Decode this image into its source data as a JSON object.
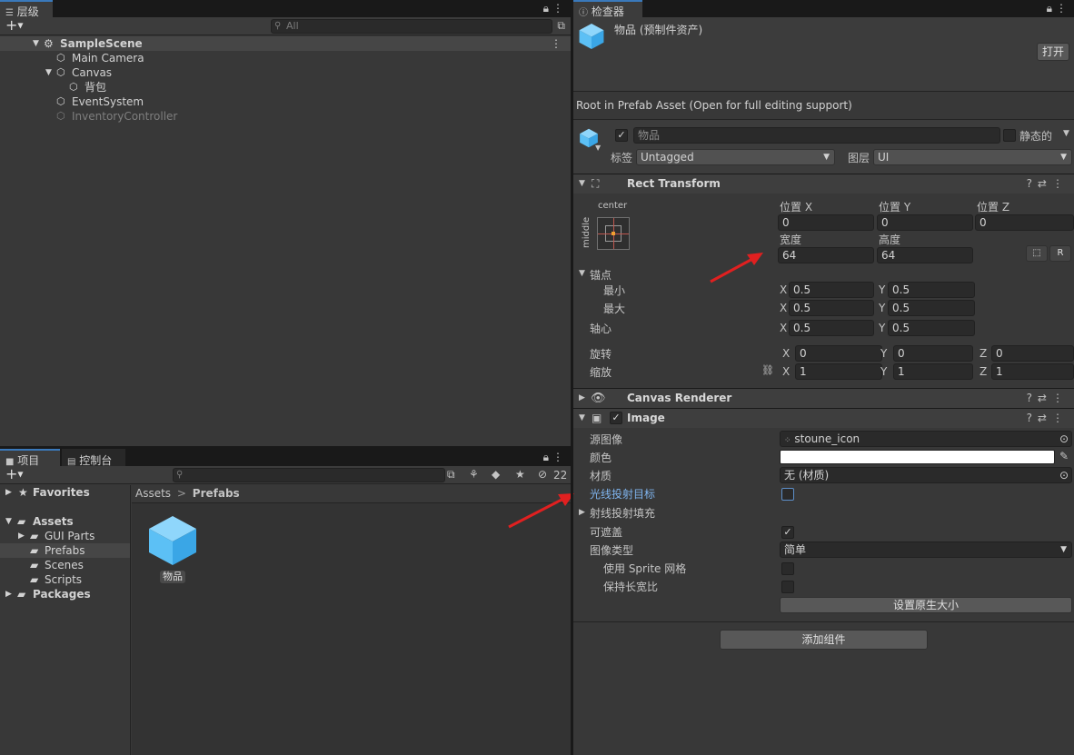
{
  "hierarchy": {
    "tab_label": "层级",
    "search_placeholder": "All",
    "items": [
      "SampleScene",
      "Main Camera",
      "Canvas",
      "背包",
      "EventSystem",
      "InventoryController"
    ]
  },
  "project": {
    "tab_project": "项目",
    "tab_console": "控制台",
    "hidden_count": "22",
    "favorites": "Favorites",
    "assets": "Assets",
    "folders": [
      "GUI Parts",
      "Prefabs",
      "Scenes",
      "Scripts"
    ],
    "packages": "Packages",
    "breadcrumb_root": "Assets",
    "breadcrumb_current": "Prefabs",
    "asset_item": "物品"
  },
  "inspector": {
    "tab_label": "检查器",
    "title": "物品 (预制件资产)",
    "open_button": "打开",
    "root_message": "Root in Prefab Asset (Open for full editing support)",
    "object_name": "物品",
    "static_label": "静态的",
    "tag_label": "标签",
    "tag_value": "Untagged",
    "layer_label": "图层",
    "layer_value": "UI",
    "rect_transform": {
      "title": "Rect Transform",
      "anchor_h": "center",
      "anchor_v": "middle",
      "pos_x_label": "位置 X",
      "pos_y_label": "位置 Y",
      "pos_z_label": "位置 Z",
      "pos_x": "0",
      "pos_y": "0",
      "pos_z": "0",
      "width_label": "宽度",
      "height_label": "高度",
      "width": "64",
      "height": "64",
      "r_button": "R",
      "anchors_label": "锚点",
      "min_label": "最小",
      "max_label": "最大",
      "min_x": "0.5",
      "min_y": "0.5",
      "max_x": "0.5",
      "max_y": "0.5",
      "pivot_label": "轴心",
      "pivot_x": "0.5",
      "pivot_y": "0.5",
      "rotation_label": "旋转",
      "rot_x": "0",
      "rot_y": "0",
      "rot_z": "0",
      "scale_label": "缩放",
      "scale_x": "1",
      "scale_y": "1",
      "scale_z": "1",
      "x": "X",
      "y": "Y",
      "z": "Z"
    },
    "canvas_renderer": {
      "title": "Canvas Renderer"
    },
    "image": {
      "title": "Image",
      "source_label": "源图像",
      "source_value": "stoune_icon",
      "color_label": "颜色",
      "material_label": "材质",
      "material_value": "无 (材质)",
      "raycast_target_label": "光线投射目标",
      "raycast_padding_label": "射线投射填充",
      "maskable_label": "可遮盖",
      "image_type_label": "图像类型",
      "image_type_value": "简单",
      "use_sprite_mesh_label": "使用 Sprite 网格",
      "preserve_aspect_label": "保持长宽比",
      "set_native_size": "设置原生大小"
    },
    "add_component": "添加组件"
  },
  "colors": {
    "accent": "#3a79bb",
    "cube": "#5cc0f5",
    "annotation_arrow": "#e02020"
  }
}
